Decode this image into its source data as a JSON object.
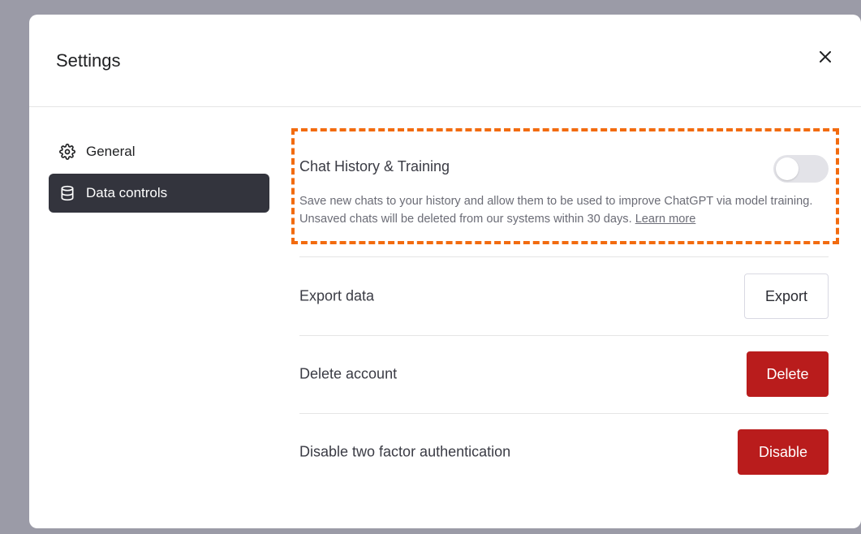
{
  "modal": {
    "title": "Settings",
    "close_icon": "close-icon"
  },
  "sidebar": {
    "items": [
      {
        "label": "General",
        "icon": "gear-icon",
        "active": false
      },
      {
        "label": "Data controls",
        "icon": "database-icon",
        "active": true
      }
    ]
  },
  "data_controls": {
    "history": {
      "title": "Chat History & Training",
      "toggle_on": false,
      "description": "Save new chats to your history and allow them to be used to improve ChatGPT via model training. Unsaved chats will be deleted from our systems within 30 days.",
      "learn_more": "Learn more"
    },
    "export": {
      "label": "Export data",
      "button": "Export"
    },
    "delete": {
      "label": "Delete account",
      "button": "Delete"
    },
    "disable_2fa": {
      "label": "Disable two factor authentication",
      "button": "Disable"
    }
  },
  "colors": {
    "overlay": "#9b9ba7",
    "active_nav": "#33343d",
    "danger": "#b91c1c",
    "highlight": "#f26b0f"
  }
}
